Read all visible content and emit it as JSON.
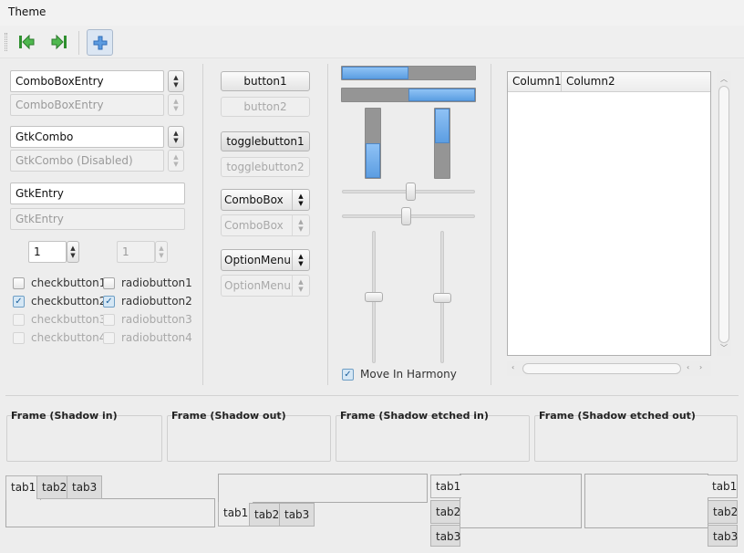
{
  "window": {
    "title": "Theme"
  },
  "toolbar": {
    "icons": [
      "go-first-icon",
      "go-last-icon",
      "add-icon"
    ],
    "colors": {
      "arrow_green": "#3aa23a",
      "add_blue": "#3c78c8"
    }
  },
  "left": {
    "combo_entry_value": "ComboBoxEntry",
    "combo_entry_disabled_value": "ComboBoxEntry",
    "gtk_combo_value": "GtkCombo",
    "gtk_combo_disabled_value": "GtkCombo (Disabled)",
    "entry_value": "GtkEntry",
    "entry_disabled_value": "GtkEntry",
    "spin_value": "1",
    "spin_disabled_value": "1",
    "checks": [
      {
        "label": "checkbutton1",
        "checked": false,
        "enabled": true
      },
      {
        "label": "checkbutton2",
        "checked": true,
        "enabled": true
      },
      {
        "label": "checkbutton3",
        "checked": false,
        "enabled": false
      },
      {
        "label": "checkbutton4",
        "checked": false,
        "enabled": false
      }
    ],
    "radios": [
      {
        "label": "radiobutton1",
        "checked": false,
        "enabled": true
      },
      {
        "label": "radiobutton2",
        "checked": true,
        "enabled": true
      },
      {
        "label": "radiobutton3",
        "checked": false,
        "enabled": false
      },
      {
        "label": "radiobutton4",
        "checked": false,
        "enabled": false
      }
    ]
  },
  "middle": {
    "button1": "button1",
    "button2": "button2",
    "togglebutton1": "togglebutton1",
    "togglebutton2": "togglebutton2",
    "combobox": "ComboBox",
    "combobox_disabled": "ComboBox",
    "optionmenu": "OptionMenu",
    "optionmenu_disabled": "OptionMenu"
  },
  "progress": {
    "h1": 0.5,
    "h2": 0.5,
    "v1": 0.5,
    "v2": 0.5,
    "fill_color": "#6aaae8"
  },
  "scales": {
    "h1": 0.5,
    "h2": 0.5,
    "v1": 0.5,
    "v2": 0.5,
    "move_in_harmony_label": "Move In Harmony",
    "move_in_harmony_checked": true
  },
  "tree": {
    "columns": [
      "Column1",
      "Column2"
    ]
  },
  "frames": [
    {
      "label": "Frame (Shadow in)"
    },
    {
      "label": "Frame (Shadow out)"
    },
    {
      "label": "Frame (Shadow etched in)"
    },
    {
      "label": "Frame (Shadow etched out)"
    }
  ],
  "notebooks": {
    "tabs": [
      "tab1",
      "tab2",
      "tab3"
    ],
    "active": "tab1"
  }
}
